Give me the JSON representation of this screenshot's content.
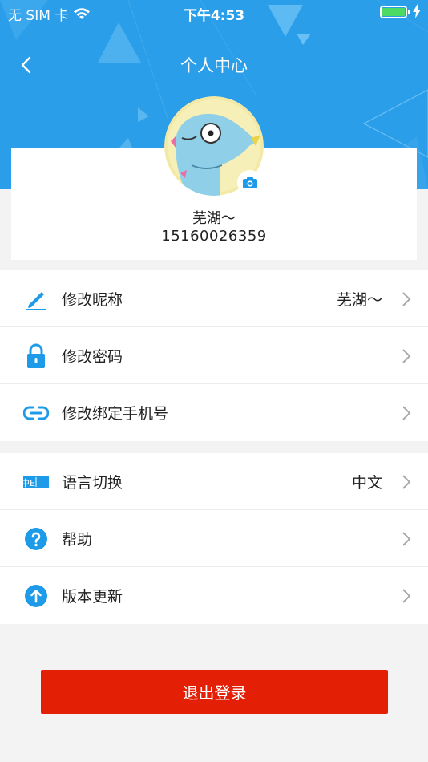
{
  "status_bar": {
    "carrier": "无 SIM 卡",
    "time": "下午4:53"
  },
  "nav": {
    "title": "个人中心"
  },
  "profile": {
    "nickname": "芜湖～",
    "phone": "15160026359"
  },
  "menu_group_1": [
    {
      "label": "修改昵称",
      "value": "芜湖～",
      "icon": "edit-pencil-icon"
    },
    {
      "label": "修改密码",
      "value": "",
      "icon": "lock-icon"
    },
    {
      "label": "修改绑定手机号",
      "value": "",
      "icon": "link-icon"
    }
  ],
  "menu_group_2": [
    {
      "label": "语言切换",
      "value": "中文",
      "icon": "language-switch-icon"
    },
    {
      "label": "帮助",
      "value": "",
      "icon": "help-question-icon"
    },
    {
      "label": "版本更新",
      "value": "",
      "icon": "update-arrow-icon"
    }
  ],
  "logout_label": "退出登录",
  "language_icon_text": "中E",
  "colors": {
    "header_blue": "#2b9ee9",
    "icon_blue": "#1e9be8",
    "logout_red": "#e31f06",
    "battery_green": "#4cd964"
  }
}
